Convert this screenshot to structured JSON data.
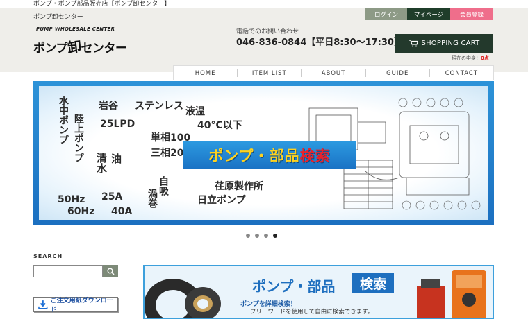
{
  "page": {
    "top_title": "ポンプ・ポンプ部品販売店【ポンプ卸センター】"
  },
  "header": {
    "site_name": "ポンプ卸センター",
    "logo_sub": "PUMP WHOLESALE CENTER",
    "logo_pre": "ポンプ",
    "logo_kanji": "卸",
    "logo_post": "センター",
    "contact_label": "電話でのお問い合わせ",
    "contact_phone": "046-836-0844【平日8:30～17:30】"
  },
  "userbar": {
    "login": "ログイン",
    "mypage": "マイページ",
    "register": "会員登録"
  },
  "cart": {
    "label": "SHOPPING CART",
    "status_prefix": "現在の中身：",
    "points": "0点",
    "icon": "cart-icon"
  },
  "nav": {
    "items": [
      "HOME",
      "ITEM LIST",
      "ABOUT",
      "GUIDE",
      "CONTACT"
    ]
  },
  "hero": {
    "words": [
      "水中ポンプ",
      "陸上ポンプ",
      "岩谷",
      "25LPD",
      "ステンレス",
      "液温",
      "40°C以下",
      "単相100",
      "三相200",
      "清水",
      "油",
      "自吸",
      "渦巻",
      "50Hz",
      "60Hz",
      "25A",
      "40A",
      "荏原製作所",
      "日立ポンプ"
    ],
    "search_pre": "ポンプ・部品",
    "search_emph": "検索"
  },
  "carousel": {
    "count": 4,
    "active": 4
  },
  "sidebar": {
    "search_title": "SEARCH",
    "search_placeholder": "",
    "download_label": "ご注文用紙ダウンロード"
  },
  "banner2": {
    "title": "ポンプ・部品",
    "search": "検索",
    "sub": "ポンプを詳細検索！",
    "sub2": "フリーワードを使用して自由に検索できます。"
  },
  "colors": {
    "accent_dark": "#23392c",
    "register": "#ef6e8b",
    "login": "#8d9a86",
    "hero_blue": "#1b6fc0",
    "search_yellow": "#ffd21f"
  }
}
